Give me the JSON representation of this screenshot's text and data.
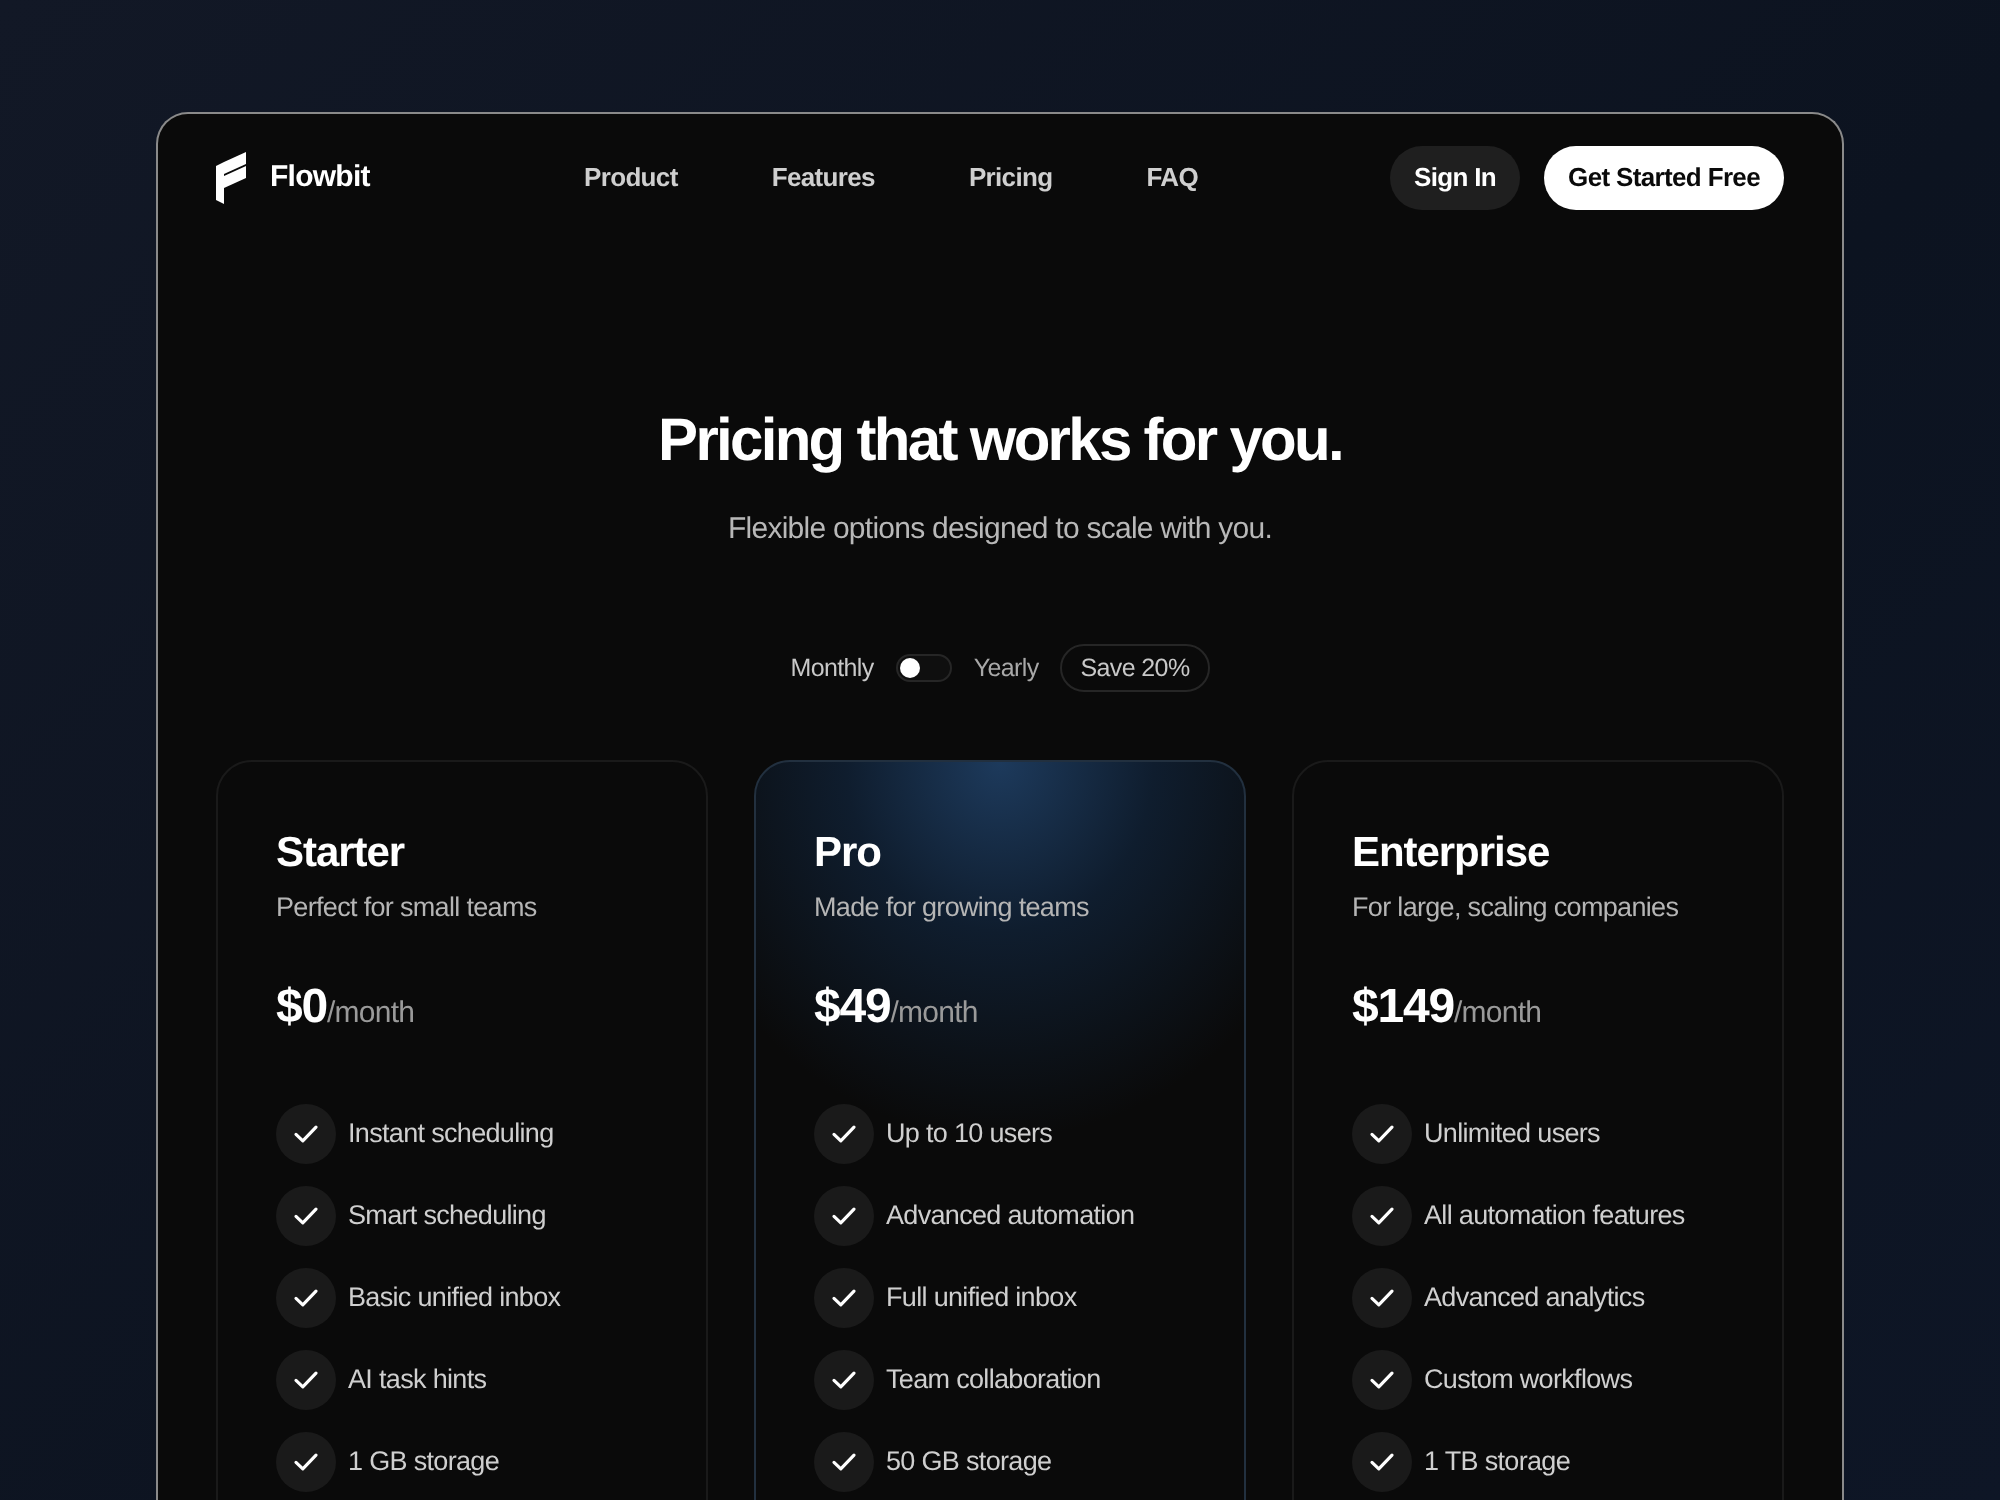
{
  "brand": {
    "name": "Flowbit"
  },
  "nav": {
    "links": [
      {
        "label": "Product"
      },
      {
        "label": "Features"
      },
      {
        "label": "Pricing"
      },
      {
        "label": "FAQ"
      }
    ],
    "actions": [
      {
        "label": "Sign In",
        "kind": "secondary"
      },
      {
        "label": "Get Started Free",
        "kind": "primary"
      }
    ]
  },
  "hero": {
    "title": "Pricing that works for you.",
    "subtitle": "Flexible options designed to scale with you."
  },
  "billing": {
    "monthly_label": "Monthly",
    "yearly_label": "Yearly",
    "on": false,
    "badge": "Save 20%"
  },
  "plans": [
    {
      "name": "Starter",
      "description": "Perfect for small teams",
      "price": "$0",
      "period": "/month",
      "featured": false,
      "features": [
        "Instant scheduling",
        "Smart scheduling",
        "Basic unified inbox",
        "AI task hints",
        "1 GB storage"
      ]
    },
    {
      "name": "Pro",
      "description": "Made for growing teams",
      "price": "$49",
      "period": "/month",
      "featured": true,
      "features": [
        "Up to 10 users",
        "Advanced automation",
        "Full unified inbox",
        "Team collaboration",
        "50 GB storage"
      ]
    },
    {
      "name": "Enterprise",
      "description": "For large, scaling companies",
      "price": "$149",
      "period": "/month",
      "featured": false,
      "features": [
        "Unlimited users",
        "All automation features",
        "Advanced analytics",
        "Custom workflows",
        "1 TB storage"
      ]
    }
  ]
}
